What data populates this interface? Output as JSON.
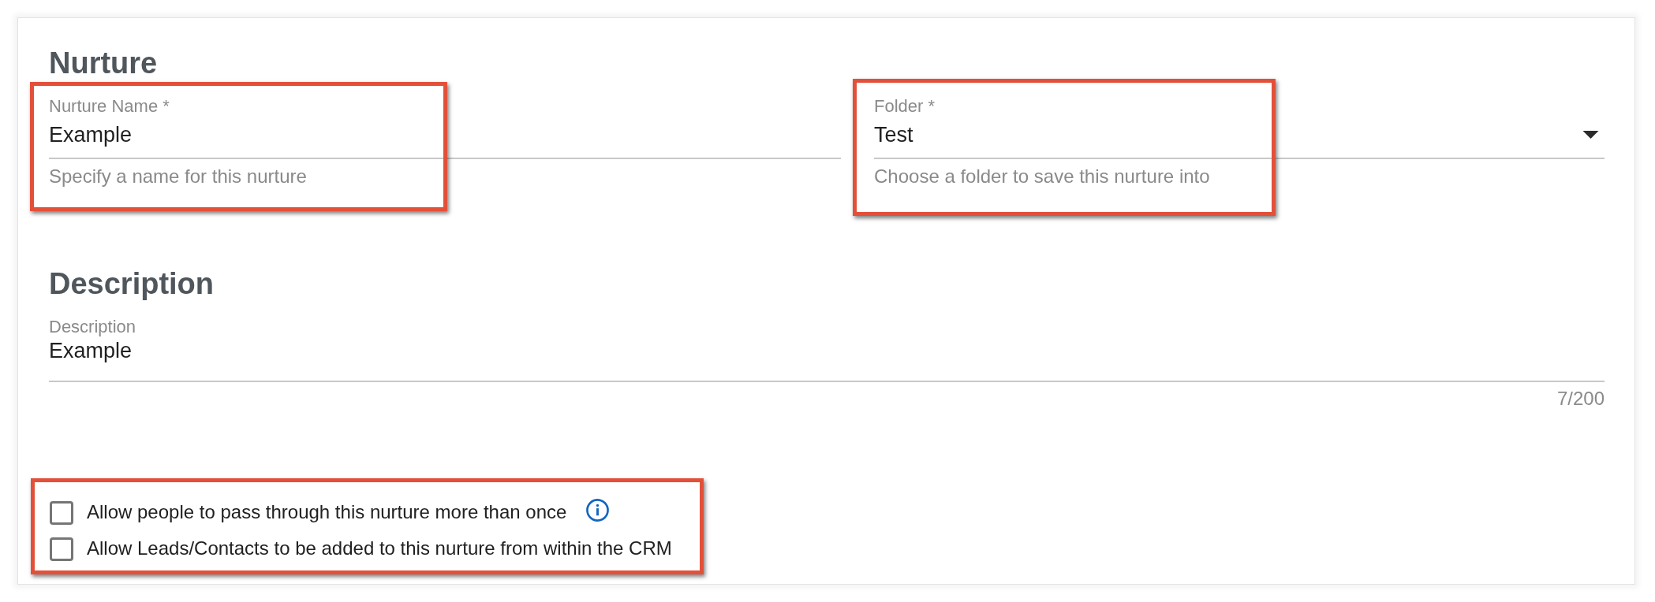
{
  "nurture": {
    "heading": "Nurture",
    "fields": [
      {
        "kind": "text",
        "label": "Nurture Name *",
        "value": "Example",
        "hint": "Specify a name for this nurture",
        "highlighted": true
      },
      {
        "kind": "select",
        "label": "Folder *",
        "value": "Test",
        "hint": "Choose a folder to save this nurture into",
        "highlighted": true
      }
    ]
  },
  "description": {
    "heading": "Description",
    "field": {
      "label": "Description",
      "value": "Example",
      "counter": "7/200"
    }
  },
  "options": {
    "highlighted": true,
    "items": [
      {
        "label": "Allow people to pass through this nurture more than once",
        "checked": false,
        "info": true
      },
      {
        "label": "Allow Leads/Contacts to be added to this nurture from within the CRM",
        "checked": false,
        "info": false
      }
    ]
  }
}
